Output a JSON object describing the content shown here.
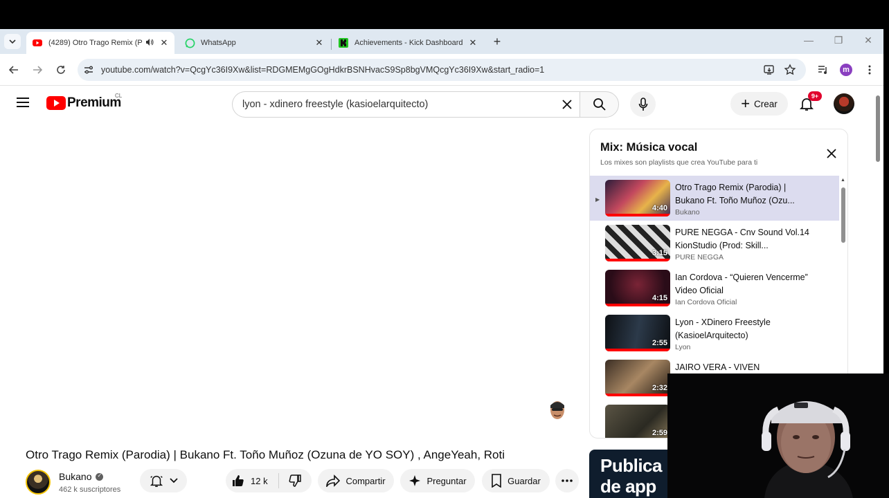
{
  "browser": {
    "tabs": [
      {
        "title": "(4289) Otro Trago Remix (P",
        "active": true,
        "audio": true
      },
      {
        "title": "WhatsApp",
        "active": false
      },
      {
        "title": "Achievements - Kick Dashboard",
        "active": false
      }
    ],
    "url": "youtube.com/watch?v=QcgYc36I9Xw&list=RDGMEMgGOgHdkrBSNHvacS9Sp8bgVMQcgYc36I9Xw&start_radio=1"
  },
  "yt": {
    "logo_text": "Premium",
    "country": "CL",
    "search_query": "lyon - xdinero freestyle (kasioelarquitecto)",
    "create_label": "Crear",
    "notifications_badge": "9+"
  },
  "playlist": {
    "title": "Mix: Música vocal",
    "subtitle": "Los mixes son playlists que crea YouTube para ti",
    "items": [
      {
        "title": "Otro Trago Remix (Parodia) | Bukano Ft. Toño Muñoz (Ozu...",
        "channel": "Bukano",
        "duration": "4:40",
        "current": true
      },
      {
        "title": "PURE NEGGA - Cnv Sound Vol.14 KionStudio (Prod: Skill...",
        "channel": "PURE NEGGA",
        "duration": "3:15"
      },
      {
        "title": "Ian Cordova - “Quieren Vencerme” Video Oficial",
        "channel": "Ian Cordova Oficial",
        "duration": "4:15"
      },
      {
        "title": "Lyon - XDinero Freestyle (KasioelArquitecto)",
        "channel": "Lyon",
        "duration": "2:55"
      },
      {
        "title": "JAIRO VERA - VIVEN",
        "channel": "",
        "duration": "2:32"
      },
      {
        "title": "",
        "channel": "",
        "duration": "2:59"
      }
    ]
  },
  "video": {
    "title": "Otro Trago Remix (Parodia) | Bukano Ft. Toño Muñoz (Ozuna de YO SOY) , AngeYeah, Roti",
    "channel": "Bukano",
    "subscribers": "462 k suscriptores",
    "likes": "12 k",
    "share_label": "Compartir",
    "ask_label": "Preguntar",
    "save_label": "Guardar"
  },
  "ad": {
    "text_line1": "Publica",
    "text_line2": "de app"
  },
  "colors": {
    "accent": "#ff0000",
    "badge": "#e1002d",
    "current_row": "#dcdcef"
  }
}
